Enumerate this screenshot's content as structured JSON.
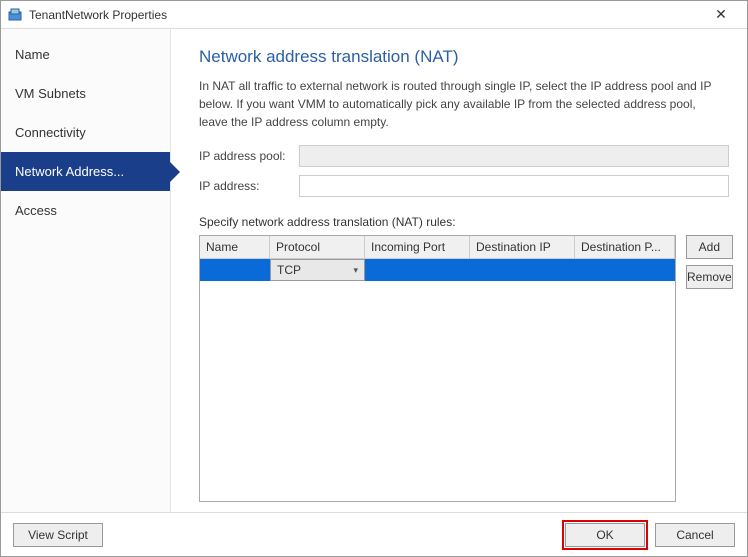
{
  "window": {
    "title": "TenantNetwork Properties",
    "close": "✕"
  },
  "sidebar": {
    "items": [
      {
        "label": "Name"
      },
      {
        "label": "VM Subnets"
      },
      {
        "label": "Connectivity"
      },
      {
        "label": "Network Address..."
      },
      {
        "label": "Access"
      }
    ],
    "selected_index": 3
  },
  "page": {
    "title": "Network address translation (NAT)",
    "description": "In NAT all traffic to external network is routed through single IP, select the IP address pool and IP below. If you want VMM to automatically pick any available IP from the selected address pool, leave the IP address column empty.",
    "ip_pool_label": "IP address pool:",
    "ip_pool_value": "",
    "ip_addr_label": "IP address:",
    "ip_addr_value": "",
    "rules_label": "Specify network address translation (NAT) rules:"
  },
  "grid": {
    "columns": [
      "Name",
      "Protocol",
      "Incoming Port",
      "Destination IP",
      "Destination P..."
    ],
    "rows": [
      {
        "name": "",
        "protocol": "TCP",
        "incoming": "",
        "dest_ip": "",
        "dest_port": ""
      }
    ]
  },
  "buttons": {
    "add": "Add",
    "remove": "Remove",
    "view_script": "View Script",
    "ok": "OK",
    "cancel": "Cancel"
  }
}
